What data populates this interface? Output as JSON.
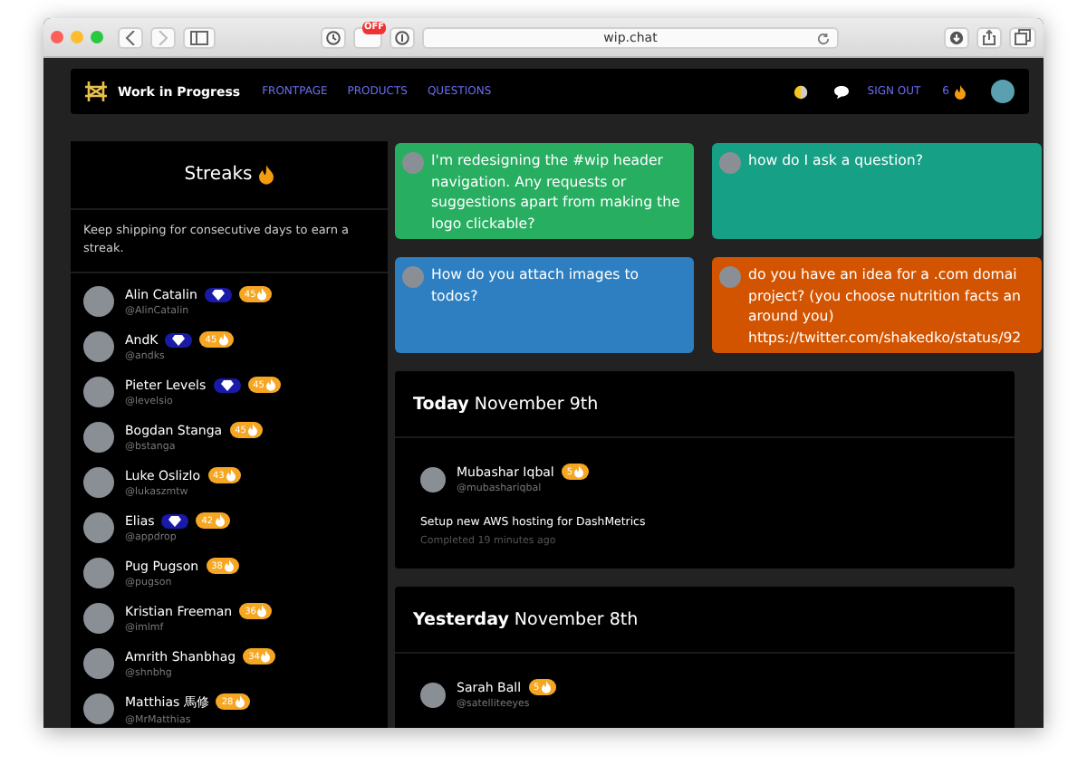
{
  "browser": {
    "url": "wip.chat",
    "badge": "OFF"
  },
  "nav": {
    "brand": "Work in Progress",
    "links": [
      "FRONTPAGE",
      "PRODUCTS",
      "QUESTIONS"
    ],
    "sign_out": "SIGN OUT",
    "streak": "6"
  },
  "streaks": {
    "title": "Streaks",
    "description": "Keep shipping for consecutive days to earn a streak.",
    "users": [
      {
        "name": "Alin Catalin",
        "handle": "@AlinCatalin",
        "streak": "45",
        "diamond": true
      },
      {
        "name": "AndK",
        "handle": "@andks",
        "streak": "45",
        "diamond": true
      },
      {
        "name": "Pieter Levels",
        "handle": "@levelsio",
        "streak": "45",
        "diamond": true
      },
      {
        "name": "Bogdan Stanga",
        "handle": "@bstanga",
        "streak": "45",
        "diamond": false
      },
      {
        "name": "Luke Oslizlo",
        "handle": "@lukaszmtw",
        "streak": "43",
        "diamond": false
      },
      {
        "name": "Elias",
        "handle": "@appdrop",
        "streak": "42",
        "diamond": true
      },
      {
        "name": "Pug Pugson",
        "handle": "@pugson",
        "streak": "38",
        "diamond": false
      },
      {
        "name": "Kristian Freeman",
        "handle": "@imlmf",
        "streak": "36",
        "diamond": false
      },
      {
        "name": "Amrith Shanbhag",
        "handle": "@shnbhg",
        "streak": "34",
        "diamond": false
      },
      {
        "name": "Matthias 馬修",
        "handle": "@MrMatthias",
        "streak": "28",
        "diamond": false
      }
    ]
  },
  "questions": [
    {
      "text": "I'm redesigning the #wip header navigation. Any requests or suggestions apart from making the logo clickable?",
      "color": "#27ae60"
    },
    {
      "text": "how do I ask a question?",
      "color": "#16a085"
    },
    {
      "text": "How do you attach images to todos?",
      "color": "#2e7fc1"
    },
    {
      "text": "do you have an idea for a .com domai project? (you choose nutrition facts an around you) https://twitter.com/shakedko/status/92",
      "color": "#d35400"
    }
  ],
  "days": [
    {
      "heading": "**Today** November 9th",
      "items": [
        {
          "name": "Mubashar Iqbal",
          "handle": "@mubashariqbal",
          "streak": "5",
          "task": "Setup new AWS hosting for DashMetrics",
          "time": "Completed 19 minutes ago"
        }
      ]
    },
    {
      "heading": "**Yesterday** November 8th",
      "items": [
        {
          "name": "Sarah Ball",
          "handle": "@satelliteeyes",
          "streak": "5"
        }
      ]
    }
  ]
}
